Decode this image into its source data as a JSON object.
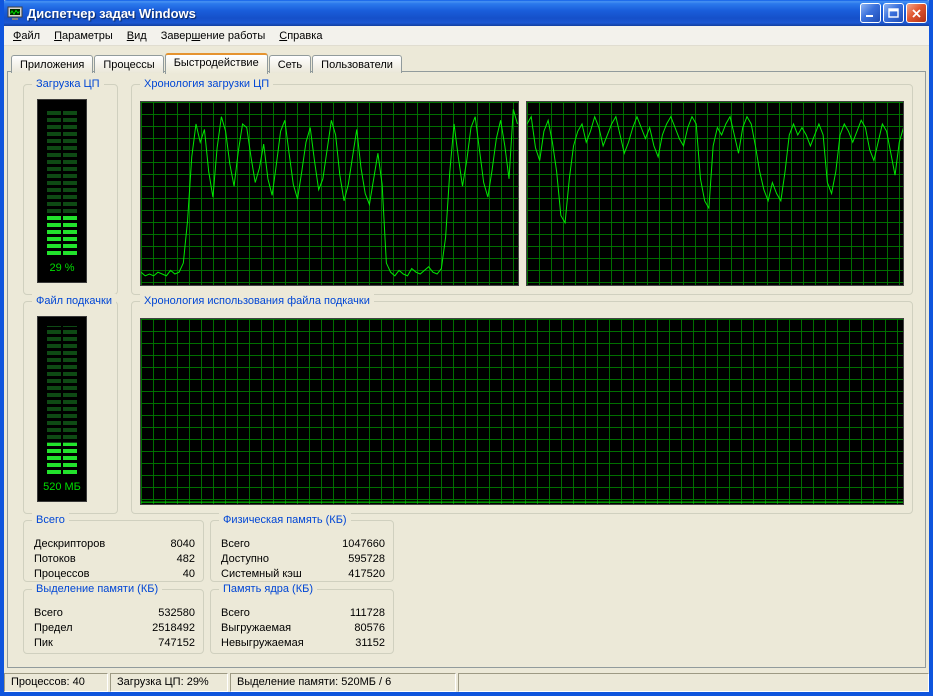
{
  "window": {
    "title": "Диспетчер задач Windows"
  },
  "menu": {
    "items": [
      {
        "label": "Файл",
        "accel": 0
      },
      {
        "label": "Параметры",
        "accel": 0
      },
      {
        "label": "Вид",
        "accel": 0
      },
      {
        "label": "Завершение работы",
        "accel": 5
      },
      {
        "label": "Справка",
        "accel": 0
      }
    ]
  },
  "tabs": [
    {
      "label": "Приложения"
    },
    {
      "label": "Процессы"
    },
    {
      "label": "Быстродействие",
      "active": true
    },
    {
      "label": "Сеть"
    },
    {
      "label": "Пользователи"
    }
  ],
  "performance": {
    "cpu_gauge": {
      "title": "Загрузка ЦП",
      "percent": 29,
      "value_label": "29 %"
    },
    "cpu_history": {
      "title": "Хронология загрузки ЦП"
    },
    "pf_gauge": {
      "title": "Файл подкачки",
      "percent": 21,
      "value_label": "520 МБ"
    },
    "pf_history": {
      "title": "Хронология использования файла подкачки"
    }
  },
  "groups": {
    "totals": {
      "title": "Всего",
      "rows": [
        [
          "Дескрипторов",
          "8040"
        ],
        [
          "Потоков",
          "482"
        ],
        [
          "Процессов",
          "40"
        ]
      ]
    },
    "physical": {
      "title": "Физическая память (КБ)",
      "rows": [
        [
          "Всего",
          "1047660"
        ],
        [
          "Доступно",
          "595728"
        ],
        [
          "Системный кэш",
          "417520"
        ]
      ]
    },
    "commit": {
      "title": "Выделение памяти (КБ)",
      "rows": [
        [
          "Всего",
          "532580"
        ],
        [
          "Предел",
          "2518492"
        ],
        [
          "Пик",
          "747152"
        ]
      ]
    },
    "kernel": {
      "title": "Память ядра (КБ)",
      "rows": [
        [
          "Всего",
          "111728"
        ],
        [
          "Выгружаемая",
          "80576"
        ],
        [
          "Невыгружаемая",
          "31152"
        ]
      ]
    }
  },
  "statusbar": {
    "processes": "Процессов: 40",
    "cpu": "Загрузка ЦП: 29%",
    "commit": "Выделение памяти: 520МБ / 6"
  },
  "colors": {
    "graph_line": "#00e600",
    "graph_grid": "#007a00",
    "led_on": "#22e32c",
    "led_off": "#0e4a14",
    "group_title": "#0046d5",
    "gauge_text": "#00dd00"
  },
  "chart_data": [
    {
      "type": "line",
      "title": "Хронология загрузки ЦП (панель 1)",
      "ylim": [
        0,
        100
      ],
      "grid": true,
      "values": [
        7,
        5,
        6,
        5,
        7,
        6,
        5,
        8,
        6,
        7,
        12,
        35,
        70,
        88,
        78,
        85,
        62,
        48,
        75,
        92,
        84,
        66,
        54,
        73,
        88,
        86,
        70,
        56,
        64,
        77,
        58,
        49,
        66,
        84,
        90,
        72,
        55,
        47,
        62,
        78,
        86,
        68,
        52,
        58,
        74,
        90,
        82,
        60,
        46,
        55,
        70,
        85,
        64,
        50,
        44,
        58,
        72,
        55,
        12,
        7,
        5,
        8,
        6,
        5,
        9,
        7,
        6,
        8,
        10,
        7,
        6,
        9,
        26,
        62,
        88,
        70,
        54,
        68,
        86,
        92,
        74,
        56,
        48,
        63,
        80,
        90,
        76,
        58,
        96,
        88
      ]
    },
    {
      "type": "line",
      "title": "Хронология загрузки ЦП (панель 2)",
      "ylim": [
        0,
        100
      ],
      "grid": true,
      "values": [
        88,
        92,
        75,
        68,
        84,
        90,
        78,
        62,
        38,
        34,
        58,
        76,
        84,
        88,
        78,
        84,
        92,
        86,
        76,
        82,
        88,
        92,
        82,
        72,
        78,
        86,
        92,
        86,
        80,
        86,
        76,
        70,
        82,
        88,
        92,
        86,
        80,
        76,
        86,
        92,
        88,
        58,
        46,
        42,
        76,
        86,
        82,
        88,
        92,
        82,
        72,
        86,
        92,
        88,
        76,
        62,
        52,
        46,
        56,
        50,
        46,
        62,
        82,
        88,
        82,
        86,
        82,
        76,
        82,
        88,
        82,
        56,
        50,
        62,
        82,
        88,
        84,
        78,
        84,
        90,
        86,
        74,
        68,
        78,
        88,
        84,
        72,
        60,
        78,
        86
      ]
    },
    {
      "type": "line",
      "title": "Хронология использования файла подкачки",
      "ylim": [
        0,
        100
      ],
      "grid": true,
      "values": [
        1,
        1,
        1,
        1,
        1,
        1,
        1,
        1,
        1,
        1,
        1,
        1,
        1,
        1,
        1,
        1,
        1,
        1,
        1,
        1,
        1,
        1,
        1,
        1,
        1,
        1,
        1,
        1,
        1,
        1
      ]
    }
  ]
}
